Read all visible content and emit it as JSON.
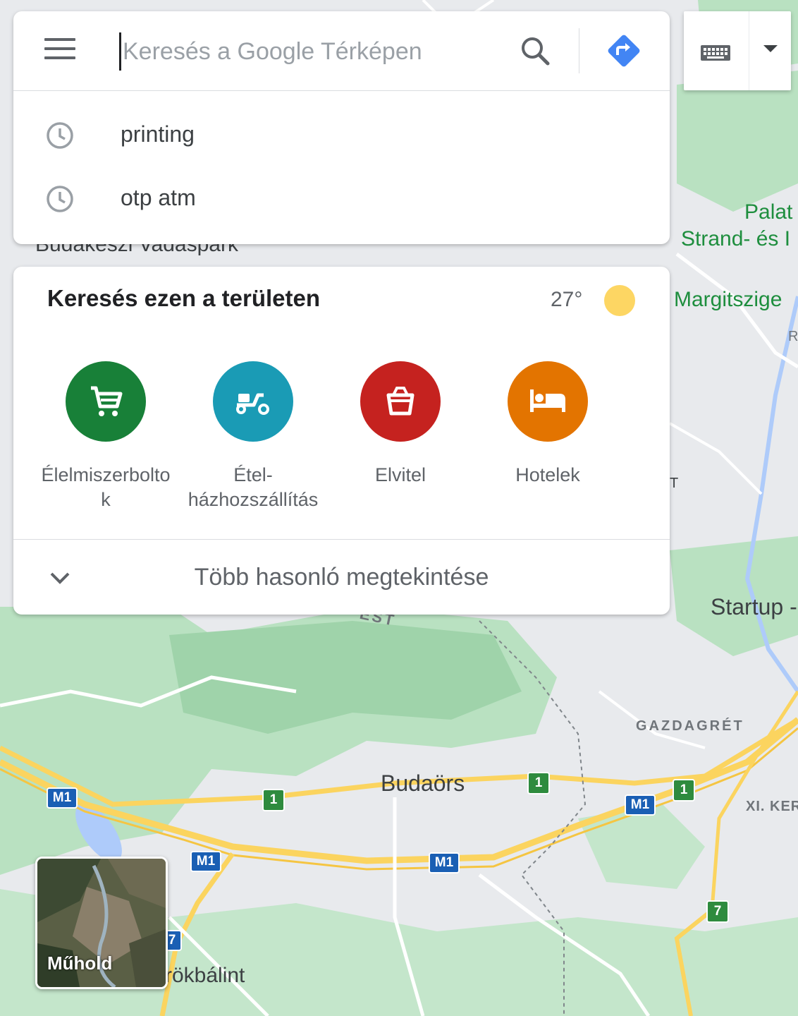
{
  "search": {
    "placeholder": "Keresés a Google Térképen"
  },
  "recent_searches": [
    {
      "label": "printing"
    },
    {
      "label": "otp atm"
    }
  ],
  "area_panel": {
    "title": "Keresés ezen a területen",
    "temperature": "27°",
    "categories": [
      {
        "label": "Élelmiszerbolto\nk",
        "icon": "shopping-cart-icon",
        "color": "#188038"
      },
      {
        "label": "Étel-\nházhozszállítás",
        "icon": "delivery-scooter-icon",
        "color": "#1a9bb5"
      },
      {
        "label": "Elvitel",
        "icon": "takeout-box-icon",
        "color": "#c5221f"
      },
      {
        "label": "Hotelek",
        "icon": "bed-icon",
        "color": "#e37400"
      }
    ],
    "more_label": "Több hasonló megtekintése"
  },
  "map": {
    "labels": {
      "budakeszi": "Budakeszi Vadaspark",
      "palat": "Palat",
      "strand": "Strand- és I",
      "margitsziget": "Margitszige",
      "startup": "Startup -",
      "gazdagret": "GAZDAGRÉT",
      "budaors": "Budaörs",
      "xi_ker": "XI. KERÜ",
      "torokbalint": "rökbálint",
      "est": "EST",
      "r": "R",
      "t": "T"
    },
    "shields": [
      "M1",
      "M1",
      "M1",
      "M1",
      "1",
      "1",
      "1",
      "7",
      "7"
    ]
  },
  "layer_toggle": {
    "label": "Műhold"
  },
  "colors": {
    "accent_blue": "#4285f4",
    "green_area": "#a8dab5",
    "road": "#fbd45f"
  }
}
